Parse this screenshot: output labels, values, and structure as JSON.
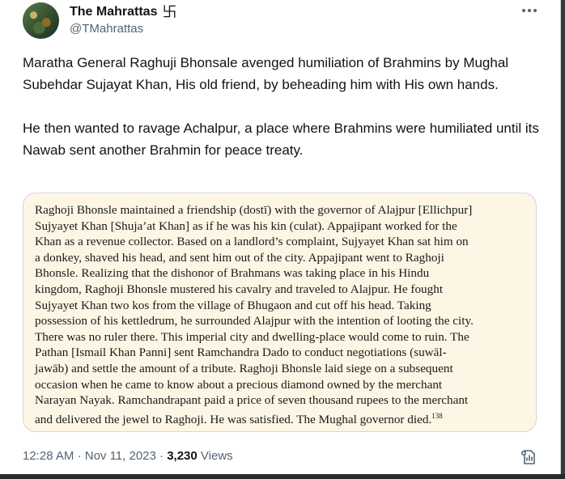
{
  "author": {
    "name": "The Mahrattas",
    "badge": "卐",
    "handle": "@TMahrattas"
  },
  "tweet": {
    "paragraphs": [
      "Maratha General Raghuji Bhonsale avenged humiliation of Brahmins by Mughal Subehdar Sujayat Khan, His old friend, by beheading him with His own hands.",
      "He then wanted to ravage Achalpur, a place where Brahmins were humiliated until its Nawab sent another Brahmin for peace treaty."
    ]
  },
  "media": {
    "excerpt_lines": [
      "Raghoji Bhonsle maintained a friendship (dostī) with the governor of Alajpur [Ellichpur]",
      "Sujyayet Khan [Shuja’at Khan] as if he was his kin (culat). Appajipant worked for the",
      "Khan as a revenue collector. Based on a landlord’s complaint, Sujyayet Khan sat him on",
      "a donkey, shaved his head, and sent him out of the city. Appajipant went to Raghoji",
      "Bhonsle. Realizing that the dishonor of Brahmans was taking place in his Hindu",
      "kingdom, Raghoji Bhonsle mustered his cavalry and traveled to Alajpur. He fought",
      "Sujyayet Khan two kos from the village of Bhugaon and cut off his head. Taking",
      "possession of his kettledrum, he surrounded Alajpur with the intention of looting the city.",
      "There was no ruler there. This imperial city and dwelling-place would come to ruin. The",
      "Pathan [Ismail Khan Panni] sent Ramchandra Dado to conduct negotiations (suwāl-",
      "jawāb) and settle the amount of a tribute. Raghoji Bhonsle laid siege on a subsequent",
      "occasion when he came to know about a precious diamond owned by the merchant",
      "Narayan Nayak. Ramchandrapant paid a price of seven thousand rupees to the merchant",
      "and delivered the jewel to Raghoji. He was satisfied. The Mughal governor died."
    ],
    "footnote": "138"
  },
  "meta": {
    "time": "12:28 AM",
    "separator": "·",
    "date": "Nov 11, 2023",
    "views_count": "3,230",
    "views_label": "Views"
  },
  "icons": {
    "more": "more-horizontal-icon",
    "analytics": "view-analytics-icon"
  },
  "colors": {
    "text": "#0f1419",
    "secondary": "#536471",
    "border": "#cfd9de",
    "media_bg": "#fdf6e4"
  }
}
